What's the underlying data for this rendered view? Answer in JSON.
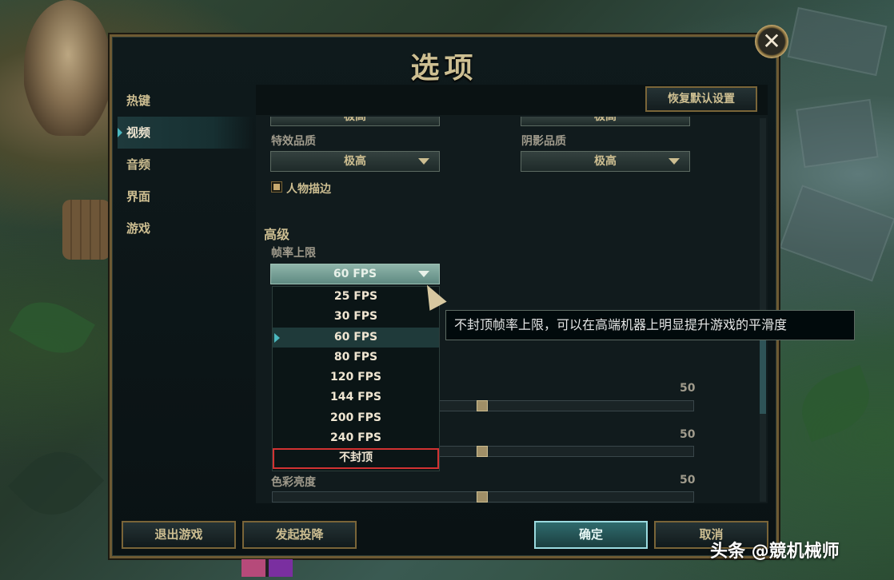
{
  "dialog": {
    "title": "选项",
    "close_label": "✕"
  },
  "nav": {
    "items": [
      {
        "label": "热键"
      },
      {
        "label": "视频"
      },
      {
        "label": "音频"
      },
      {
        "label": "界面"
      },
      {
        "label": "游戏"
      }
    ]
  },
  "toolbar": {
    "reset_label": "恢复默认设置"
  },
  "settings": {
    "partial_top": {
      "left_value": "极高",
      "right_value": "极高"
    },
    "effects_quality": {
      "label": "特效品质",
      "value": "极高"
    },
    "shadow_quality": {
      "label": "阴影品质",
      "value": "极高"
    },
    "character_outline": {
      "label": "人物描边",
      "checked": true
    },
    "advanced": {
      "title": "高级"
    },
    "fps_cap": {
      "label": "帧率上限",
      "value": "60 FPS",
      "options": [
        "25 FPS",
        "30 FPS",
        "60 FPS",
        "80 FPS",
        "120 FPS",
        "144 FPS",
        "200 FPS",
        "240 FPS",
        "不封顶"
      ]
    },
    "sliders": [
      {
        "label": "",
        "value": "50"
      },
      {
        "label": "",
        "value": "50"
      },
      {
        "label": "色彩亮度",
        "value": "50"
      }
    ]
  },
  "tooltip": {
    "text": "不封顶帧率上限，可以在高端机器上明显提升游戏的平滑度"
  },
  "footer": {
    "exit_label": "退出游戏",
    "surrender_label": "发起投降",
    "ok_label": "确定",
    "cancel_label": "取消"
  },
  "watermark": "头条 @競机械师",
  "colors": {
    "accent": "#4bb8bf",
    "gold": "#cdbe91",
    "highlight_box": "#d23232"
  }
}
